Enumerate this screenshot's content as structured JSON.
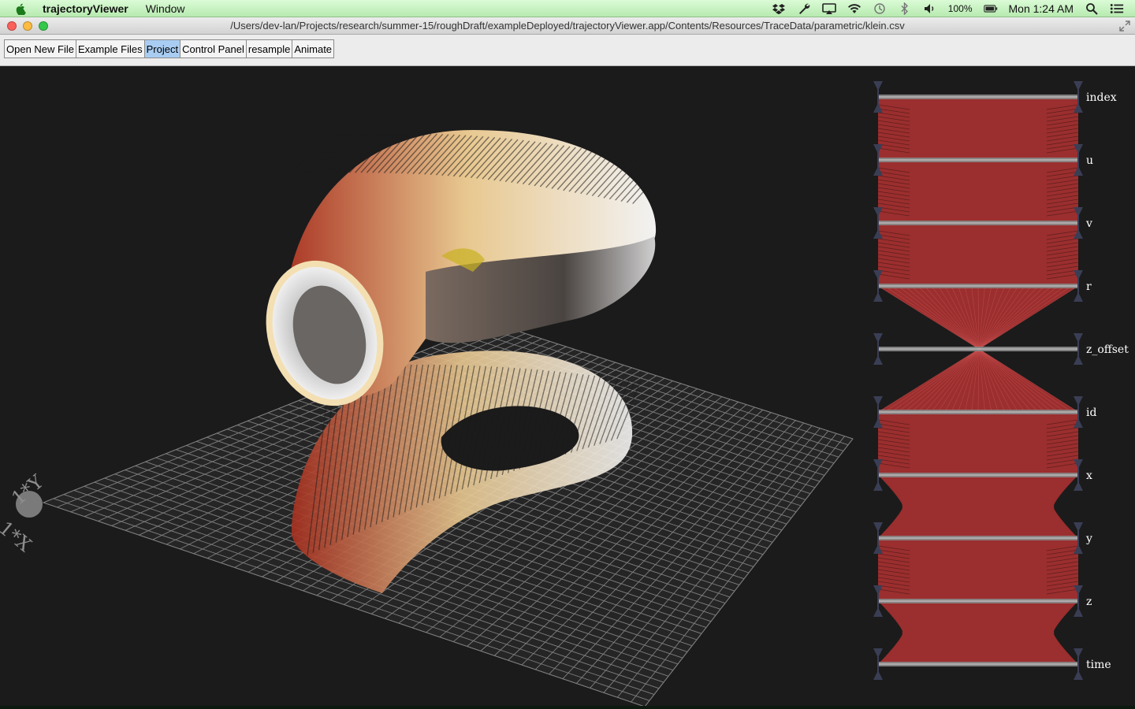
{
  "menubar": {
    "app_name": "trajectoryViewer",
    "menus": [
      "Window"
    ],
    "battery": "100%",
    "clock": "Mon 1:24 AM",
    "status_icons": [
      "dropbox-icon",
      "wrench-icon",
      "airplay-icon",
      "wifi-icon",
      "time-machine-icon",
      "bluetooth-icon",
      "volume-icon",
      "battery-icon",
      "spotlight-icon",
      "notification-center-icon"
    ]
  },
  "window": {
    "title": "/Users/dev-lan/Projects/research/summer-15/roughDraft/exampleDeployed/trajectoryViewer.app/Contents/Resources/TraceData/parametric/klein.csv"
  },
  "toolbar": {
    "buttons": [
      {
        "label": "Open New File",
        "active": false
      },
      {
        "label": "Example Files",
        "active": false
      },
      {
        "label": "Project",
        "active": true
      },
      {
        "label": "Control Panel",
        "active": false
      },
      {
        "label": "resample",
        "active": false
      },
      {
        "label": "Animate",
        "active": false
      }
    ]
  },
  "viewport": {
    "gizmo_labels": [
      "1*Y",
      "1*X"
    ],
    "grid_color": "#7f7f7f",
    "surface_colors": [
      "#a83020",
      "#e8c890",
      "#f2f2f2"
    ]
  },
  "parallel_coordinates": {
    "axes": [
      "index",
      "u",
      "v",
      "r",
      "z_offset",
      "id",
      "x",
      "y",
      "z",
      "time"
    ],
    "line_color": "#9b2e2e"
  }
}
